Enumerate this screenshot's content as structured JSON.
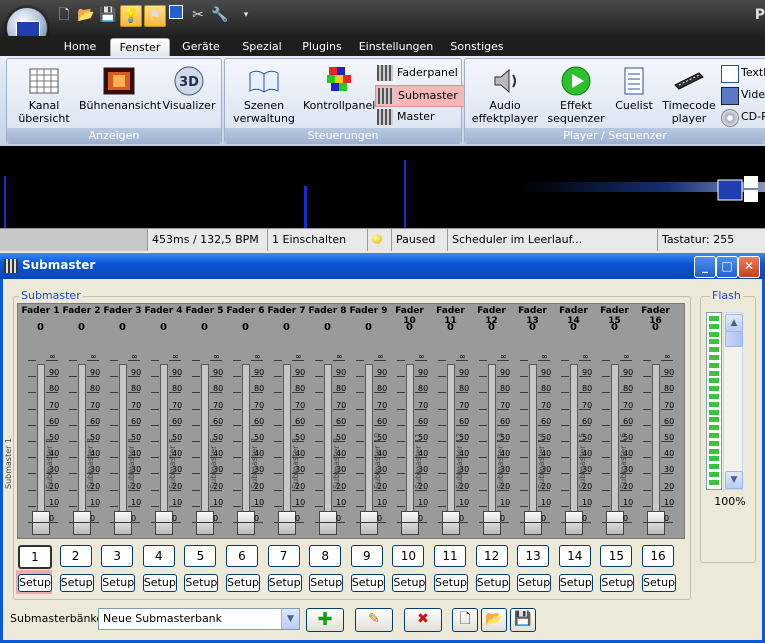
{
  "app": {
    "title_partial": "P",
    "tabs": [
      "Home",
      "Fenster",
      "Geräte",
      "Spezial",
      "Plugins",
      "Einstellungen",
      "Sonstiges"
    ],
    "active_tab": "Fenster"
  },
  "ribbon": {
    "groups": [
      {
        "caption": "Anzeigen",
        "buttons": [
          "Kanal\nübersicht",
          "Bühnenansicht",
          "Visualizer"
        ]
      },
      {
        "caption": "Steuerungen",
        "buttons": [
          "Szenen\nverwaltung",
          "Kontrollpanel"
        ],
        "small": [
          "Faderpanel",
          "Submaster",
          "Master"
        ]
      },
      {
        "caption": "Player / Sequenzer",
        "buttons": [
          "Audio\neffektplayer",
          "Effekt\nsequenzer",
          "Cuelist",
          "Timecode\nplayer"
        ],
        "small": [
          "Textb",
          "Video",
          "CD-Pl"
        ]
      }
    ],
    "highlighted": "Submaster"
  },
  "status": {
    "timing": "453ms / 132,5 BPM",
    "einschalten": "1 Einschalten",
    "state": "Paused",
    "scheduler": "Scheduler im Leerlauf...",
    "keyboard": "Tastatur: 255"
  },
  "window": {
    "title": "Submaster",
    "group_label": "Submaster",
    "flash_label": "Flash",
    "flash_value": "100%",
    "flash_level": 1.0,
    "faders": [
      {
        "name": "Fader 1",
        "value": "0",
        "label": "Submaster 1"
      },
      {
        "name": "Fader 2",
        "value": "0",
        "label": "Submaster 2"
      },
      {
        "name": "Fader 3",
        "value": "0",
        "label": "Submaster 3"
      },
      {
        "name": "Fader 4",
        "value": "0",
        "label": "Submaster 4"
      },
      {
        "name": "Fader 5",
        "value": "0",
        "label": "Submaster 5"
      },
      {
        "name": "Fader 6",
        "value": "0",
        "label": "Submaster 6"
      },
      {
        "name": "Fader 7",
        "value": "0",
        "label": "Submaster 7"
      },
      {
        "name": "Fader 8",
        "value": "0",
        "label": "Submaster 8"
      },
      {
        "name": "Fader 9",
        "value": "0",
        "label": "Submaster 9"
      },
      {
        "name": "Fader 10",
        "value": "0",
        "label": "Submaster 10"
      },
      {
        "name": "Fader 11",
        "value": "0",
        "label": "Submaster 11"
      },
      {
        "name": "Fader 12",
        "value": "0",
        "label": "Submaster 12"
      },
      {
        "name": "Fader 13",
        "value": "0",
        "label": "Submaster 13"
      },
      {
        "name": "Fader 14",
        "value": "0",
        "label": "Submaster 14"
      },
      {
        "name": "Fader 15",
        "value": "0",
        "label": "Submaster 15"
      },
      {
        "name": "Fader 16",
        "value": "0",
        "label": "Submaster 16"
      }
    ],
    "scale": [
      "∞",
      "90",
      "80",
      "70",
      "60",
      "50",
      "40",
      "30",
      "20",
      "10",
      "0"
    ],
    "bank_buttons": [
      "1",
      "2",
      "3",
      "4",
      "5",
      "6",
      "7",
      "8",
      "9",
      "10",
      "11",
      "12",
      "13",
      "14",
      "15",
      "16"
    ],
    "selected_bank_button": "1",
    "setup_label": "Setup",
    "bank_label": "Submasterbänke:",
    "bank_value": "Neue Submasterbank"
  }
}
